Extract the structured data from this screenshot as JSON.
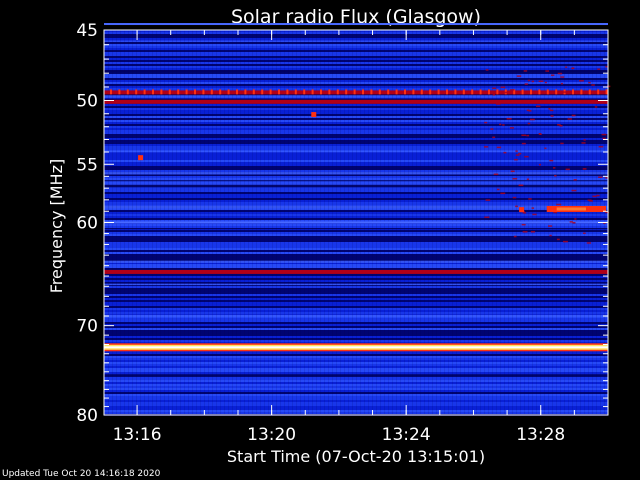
{
  "footer_text": "Updated Tue Oct 20 14:16:18 2020",
  "chart_data": {
    "type": "heatmap",
    "title": "Solar radio Flux (Glasgow)",
    "xlabel": "Start Time (07-Oct-20 13:15:01)",
    "ylabel": "Frequency [MHz]",
    "x_axis": {
      "unit": "time",
      "range": [
        "13:15:01",
        "13:30:00"
      ],
      "ticks": [
        "13:16",
        "13:20",
        "13:24",
        "13:28"
      ]
    },
    "y_axis": {
      "unit": "MHz",
      "range": [
        45,
        80
      ],
      "scale": "log",
      "ticks": [
        45,
        50,
        55,
        60,
        70,
        80
      ],
      "inverted": true
    },
    "colormap": [
      "#000060",
      "#0018c8",
      "#1c3cf0",
      "#b00018",
      "#ff3010",
      "#ffe060",
      "#ffffff"
    ],
    "bands": [
      {
        "freq": 44.6,
        "intensity": "low"
      },
      {
        "freq": 49.4,
        "intensity": "medium"
      },
      {
        "freq": 50.1,
        "intensity": "medium"
      },
      {
        "freq": 60.0,
        "intensity": "low"
      },
      {
        "freq": 64.6,
        "intensity": "medium"
      },
      {
        "freq": 72.3,
        "intensity": "high"
      }
    ],
    "bursts": [
      {
        "time": "13:16",
        "freq": 54.5
      },
      {
        "time": "13:21",
        "freq": 51.1
      },
      {
        "time": "13:27",
        "freq": 58.9
      },
      {
        "time": "13:28-13:30",
        "freq": 58.8
      }
    ]
  }
}
